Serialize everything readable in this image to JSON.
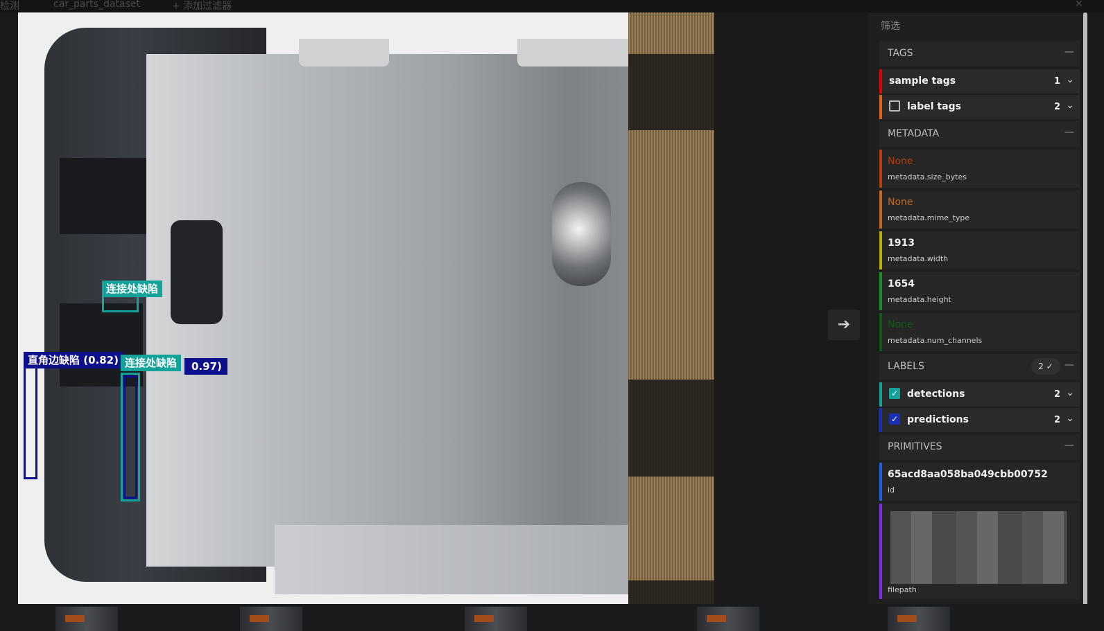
{
  "topbar": {
    "title_partial": "检测",
    "dataset": "car_parts_dataset",
    "add_filter": "+ 添加过滤器",
    "close_icon": "close-icon"
  },
  "viewer": {
    "detections": [
      {
        "label": "连接处缺陷",
        "color": "#13a39a"
      },
      {
        "label": "直角边缺陷 (0.82)",
        "color": "#0d0f8c"
      },
      {
        "label": "连接处缺陷",
        "color": "#13a39a"
      },
      {
        "label_suffix": "0.97)",
        "color": "#0d0f8c"
      }
    ],
    "next_icon": "arrow-right-icon"
  },
  "sidebar": {
    "title": "筛选",
    "sections": {
      "tags": "TAGS",
      "metadata": "METADATA",
      "labels": "LABELS",
      "labels_count": "2 ✓",
      "primitives": "PRIMITIVES"
    },
    "tags": [
      {
        "label": "sample tags",
        "count": "1",
        "color": "#e00000"
      },
      {
        "label": "label tags",
        "count": "2",
        "color": "#e0641a"
      }
    ],
    "metadata": [
      {
        "value": "None",
        "key": "metadata.size_bytes",
        "color": "#b53d0a"
      },
      {
        "value": "None",
        "key": "metadata.mime_type",
        "color": "#c06a24"
      },
      {
        "value": "1913",
        "key": "metadata.width",
        "color": "#b9b000"
      },
      {
        "value": "1654",
        "key": "metadata.height",
        "color": "#1d8f22"
      },
      {
        "value": "None",
        "key": "metadata.num_channels",
        "color": "#0f5a16"
      }
    ],
    "labels": [
      {
        "label": "detections",
        "count": "2",
        "color": "#13a39a"
      },
      {
        "label": "predictions",
        "count": "2",
        "color": "#1b2fb8"
      }
    ],
    "primitives": [
      {
        "value": "65acd8aa058ba049cbb00752",
        "key": "id",
        "color": "#1c5fe0"
      },
      {
        "key": "filepath",
        "color": "#7a2fe0"
      }
    ]
  }
}
